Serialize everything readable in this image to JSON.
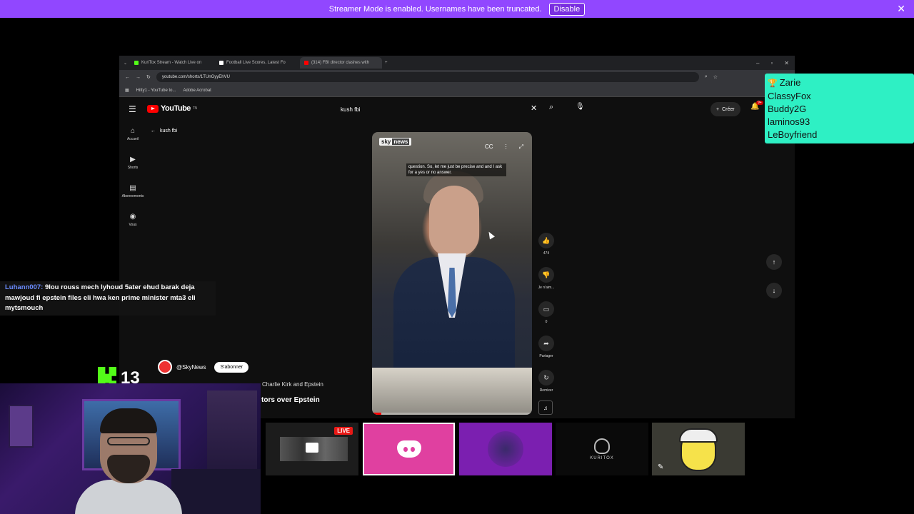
{
  "banner": {
    "message": "Streamer Mode is enabled. Usernames have been truncated.",
    "disable_label": "Disable",
    "close_glyph": "✕"
  },
  "browser": {
    "tabs": [
      {
        "title": "KuriTox Stream - Watch Live on",
        "color": "#53fc18"
      },
      {
        "title": "Football Live Scores, Latest Fo",
        "color": "#ffffff"
      },
      {
        "title": "(314) FBI director clashes with",
        "color": "#ff0000"
      }
    ],
    "url": "youtube.com/shorts/1TUnGyyEhVU",
    "bookmarks": [
      "Hitty1 - YouTube to...",
      "Adobe Acrobat"
    ]
  },
  "youtube": {
    "logo_text": "YouTube",
    "region": "TN",
    "search_query": "kush fbi",
    "create_label": "Créer",
    "notif_count": "9+",
    "nav": [
      {
        "icon": "home-icon",
        "label": "Accueil"
      },
      {
        "icon": "shorts-icon",
        "label": "Shorts"
      },
      {
        "icon": "subscriptions-icon",
        "label": "Abonnements"
      },
      {
        "icon": "you-icon",
        "label": "Vous"
      }
    ],
    "back_label": "kush fbi",
    "video": {
      "brand": "sky",
      "brand_tag": "news",
      "caption": "question. So, let me just be precise and and I ask for a yes or no answer.",
      "progress_pct": 0.06
    },
    "actions": [
      {
        "icon": "like-icon",
        "label": "474"
      },
      {
        "icon": "dislike-icon",
        "label": "Je n'aim..."
      },
      {
        "icon": "comment-icon",
        "label": "0"
      },
      {
        "icon": "share-icon",
        "label": "Partager"
      },
      {
        "icon": "remix-icon",
        "label": "Remixer"
      }
    ],
    "channel_handle": "@SkyNews",
    "subscribe_label": "S'abonner",
    "title_line1": "Charlie Kirk and Epstein",
    "title_line2": "tors over Epstein"
  },
  "leaderboard": {
    "names": [
      "Zarie",
      "ClassyFox",
      "Buddy2G",
      "laminos93",
      "LeBoyfriend"
    ]
  },
  "chat": {
    "user": "Luhann007:",
    "message": " 9lou rouss mech lyhoud 5ater ehud barak deja mawjoud fi epstein files eli hwa ken prime minister mta3 eli mytsmouch"
  },
  "kick": {
    "count": "13"
  },
  "tiles": {
    "live_label": "LIVE",
    "kuritox_text": "KURITOX"
  }
}
